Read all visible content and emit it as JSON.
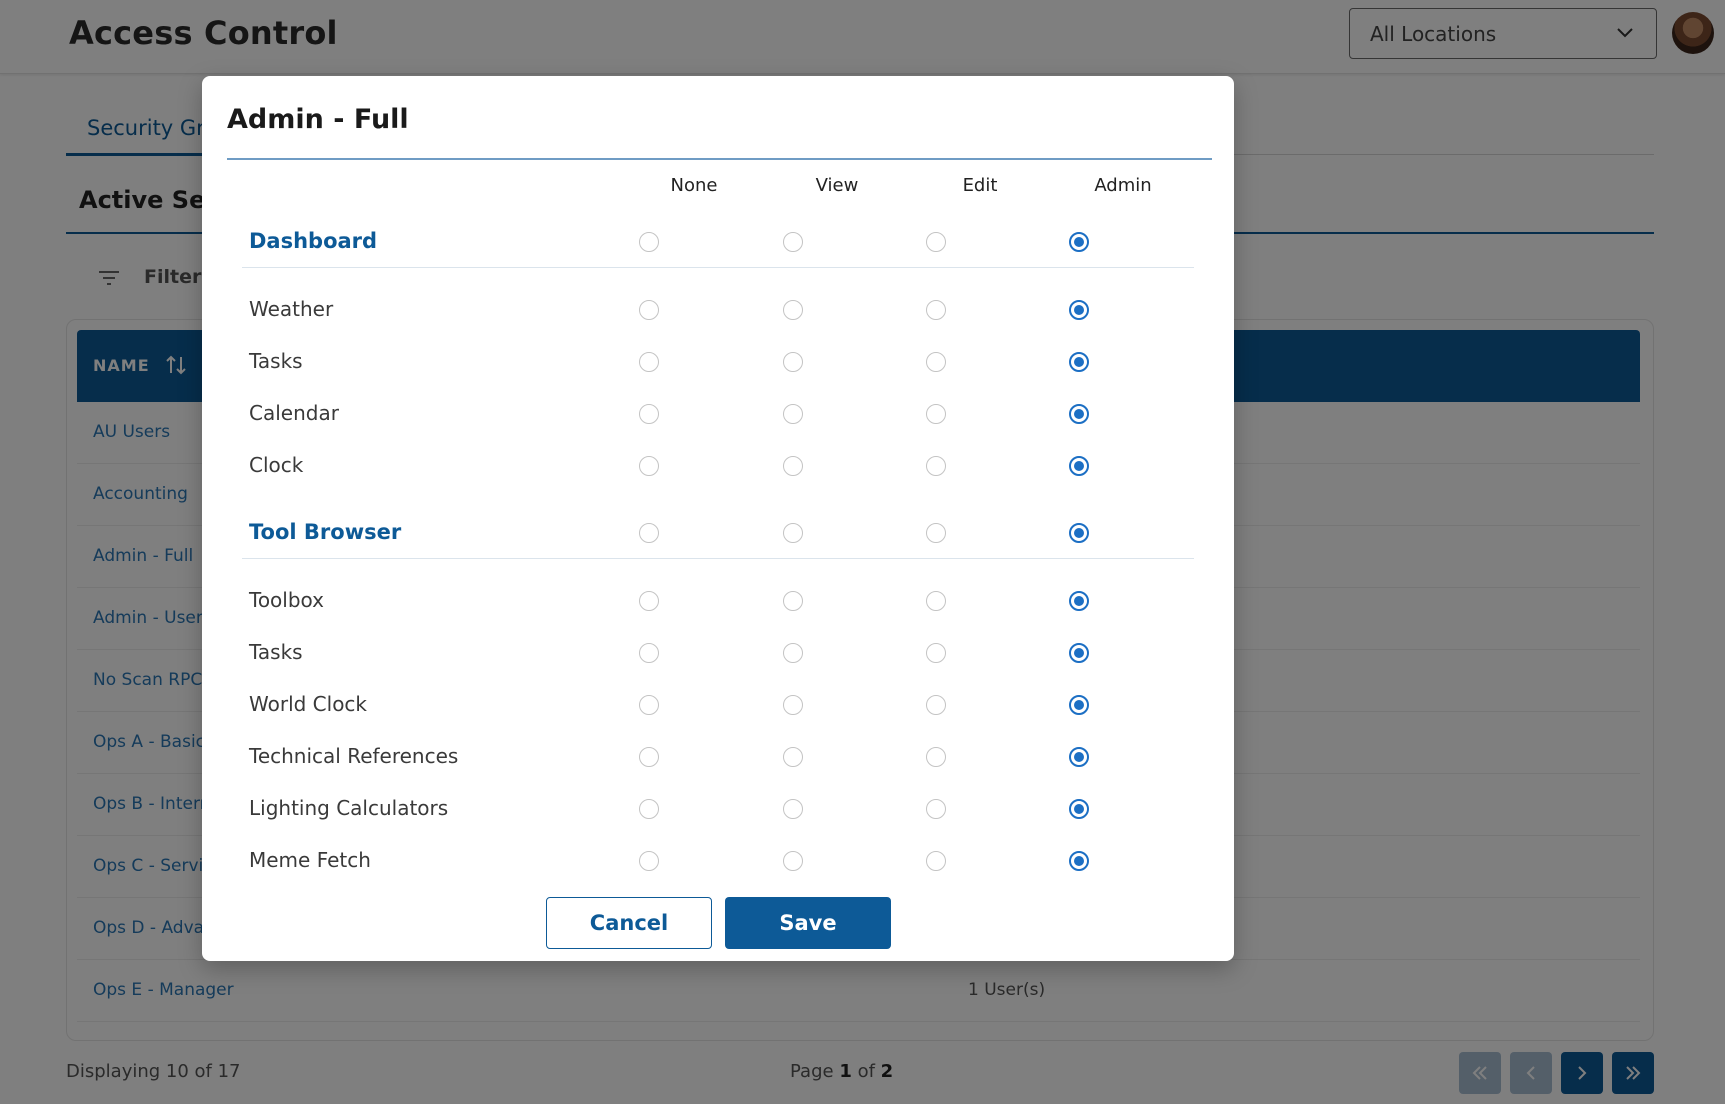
{
  "header": {
    "title": "Access Control",
    "location_select": {
      "value": "All Locations"
    }
  },
  "tabs": [
    {
      "label": "Security Gr"
    }
  ],
  "section": {
    "title": "Active Sec"
  },
  "filter": {
    "label": "Filter E"
  },
  "table": {
    "column_name": "NAME",
    "rows": [
      {
        "name": "AU Users",
        "users": ""
      },
      {
        "name": "Accounting",
        "users": ""
      },
      {
        "name": "Admin - Full",
        "users": ""
      },
      {
        "name": "Admin - User",
        "users": ""
      },
      {
        "name": "No Scan RPC",
        "users": ""
      },
      {
        "name": "Ops A - Basic",
        "users": ""
      },
      {
        "name": "Ops B - Intern",
        "users": ""
      },
      {
        "name": "Ops C - Servic",
        "users": ""
      },
      {
        "name": "Ops D - Adva",
        "users": ""
      },
      {
        "name": "Ops E - Manager",
        "users": "1 User(s)"
      }
    ]
  },
  "footer": {
    "displaying": "Displaying 10 of 17",
    "page_prefix": "Page ",
    "page_current": "1",
    "page_of": " of ",
    "page_total": "2"
  },
  "modal": {
    "title": "Admin - Full",
    "columns": [
      "None",
      "View",
      "Edit",
      "Admin"
    ],
    "permissions": [
      {
        "label": "Dashboard",
        "group": true,
        "selected": "Admin"
      },
      {
        "label": "Weather",
        "group": false,
        "selected": "Admin"
      },
      {
        "label": "Tasks",
        "group": false,
        "selected": "Admin"
      },
      {
        "label": "Calendar",
        "group": false,
        "selected": "Admin"
      },
      {
        "label": "Clock",
        "group": false,
        "selected": "Admin"
      },
      {
        "label": "Tool Browser",
        "group": true,
        "selected": "Admin"
      },
      {
        "label": "Toolbox",
        "group": false,
        "selected": "Admin"
      },
      {
        "label": "Tasks",
        "group": false,
        "selected": "Admin"
      },
      {
        "label": "World Clock",
        "group": false,
        "selected": "Admin"
      },
      {
        "label": "Technical References",
        "group": false,
        "selected": "Admin"
      },
      {
        "label": "Lighting Calculators",
        "group": false,
        "selected": "Admin"
      },
      {
        "label": "Meme Fetch",
        "group": false,
        "selected": "Admin"
      }
    ],
    "cancel_label": "Cancel",
    "save_label": "Save"
  },
  "colors": {
    "primary": "#0d5a97",
    "radio_selected": "#1c6fc4",
    "link": "#2a76b5"
  }
}
